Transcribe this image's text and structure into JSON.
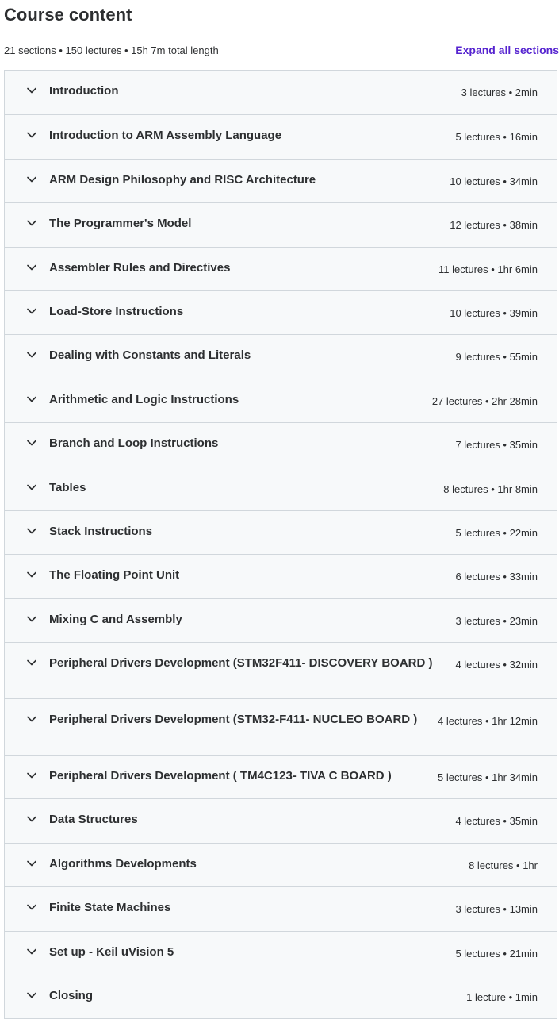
{
  "header": {
    "title": "Course content",
    "summary": "21 sections • 150 lectures • 15h 7m total length",
    "expand_label": "Expand all sections"
  },
  "sections": [
    {
      "title": "Introduction",
      "info": "3 lectures • 2min"
    },
    {
      "title": "Introduction to ARM Assembly Language",
      "info": "5 lectures • 16min"
    },
    {
      "title": "ARM Design Philosophy and RISC Architecture",
      "info": "10 lectures • 34min"
    },
    {
      "title": "The Programmer's Model",
      "info": "12 lectures • 38min"
    },
    {
      "title": "Assembler Rules and Directives",
      "info": "11 lectures • 1hr 6min"
    },
    {
      "title": "Load-Store Instructions",
      "info": "10 lectures • 39min"
    },
    {
      "title": "Dealing with Constants and Literals",
      "info": "9 lectures • 55min"
    },
    {
      "title": "Arithmetic and Logic Instructions",
      "info": "27 lectures • 2hr 28min"
    },
    {
      "title": "Branch and Loop Instructions",
      "info": "7 lectures • 35min"
    },
    {
      "title": "Tables",
      "info": "8 lectures • 1hr 8min"
    },
    {
      "title": "Stack Instructions",
      "info": "5 lectures • 22min"
    },
    {
      "title": "The Floating Point Unit",
      "info": "6 lectures • 33min"
    },
    {
      "title": "Mixing C and Assembly",
      "info": "3 lectures • 23min"
    },
    {
      "title": "Peripheral Drivers Development (STM32F411- DISCOVERY BOARD )",
      "info": "4 lectures • 32min"
    },
    {
      "title": "Peripheral Drivers Development (STM32-F411- NUCLEO BOARD )",
      "info": "4 lectures • 1hr 12min"
    },
    {
      "title": "Peripheral Drivers Development ( TM4C123- TIVA C BOARD )",
      "info": "5 lectures • 1hr 34min"
    },
    {
      "title": "Data Structures",
      "info": "4 lectures • 35min"
    },
    {
      "title": "Algorithms Developments",
      "info": "8 lectures • 1hr"
    },
    {
      "title": "Finite State Machines",
      "info": "3 lectures • 13min"
    },
    {
      "title": "Set up - Keil uVision 5",
      "info": "5 lectures • 21min"
    },
    {
      "title": "Closing",
      "info": "1 lecture • 1min"
    }
  ],
  "icons": {
    "section_toggle": "chevron-down-icon"
  },
  "colors": {
    "accent": "#5624d0",
    "text": "#2d2f31",
    "row_bg": "#f7f9fa",
    "border": "#d1d7dc"
  }
}
